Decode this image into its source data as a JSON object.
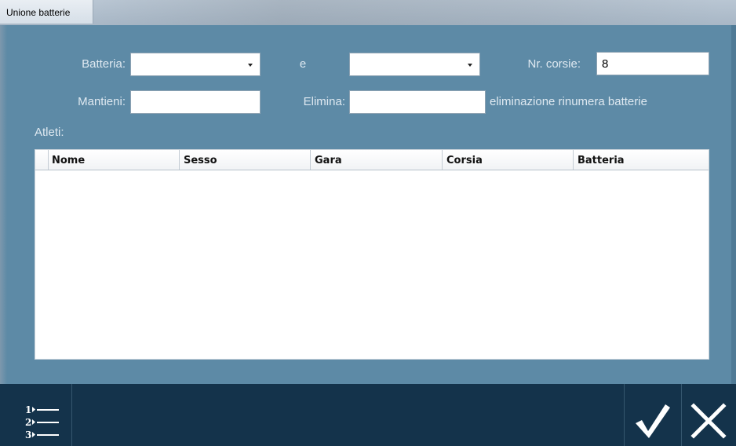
{
  "window": {
    "title": "Unione batterie"
  },
  "form": {
    "batteria_label": "Batteria:",
    "batteria_value": "",
    "e_label": "e",
    "batteria2_value": "",
    "nr_corsie_label": "Nr. corsie:",
    "nr_corsie_value": "8",
    "mantieni_label": "Mantieni:",
    "mantieni_value": "",
    "elimina_label": "Elimina:",
    "elimina_value": "",
    "elimina_note": "eliminazione rinumera batterie",
    "atleti_label": "Atleti:"
  },
  "table": {
    "columns": [
      "Nome",
      "Sesso",
      "Gara",
      "Corsia",
      "Batteria"
    ],
    "rows": []
  },
  "footer": {
    "list_icon": "numbered-list-icon",
    "ok_icon": "checkmark-icon",
    "cancel_icon": "close-icon"
  },
  "colors": {
    "dialog_bg": "#5d8aa6",
    "footer_bg": "#14334b",
    "label_text": "#dfe9f1"
  }
}
